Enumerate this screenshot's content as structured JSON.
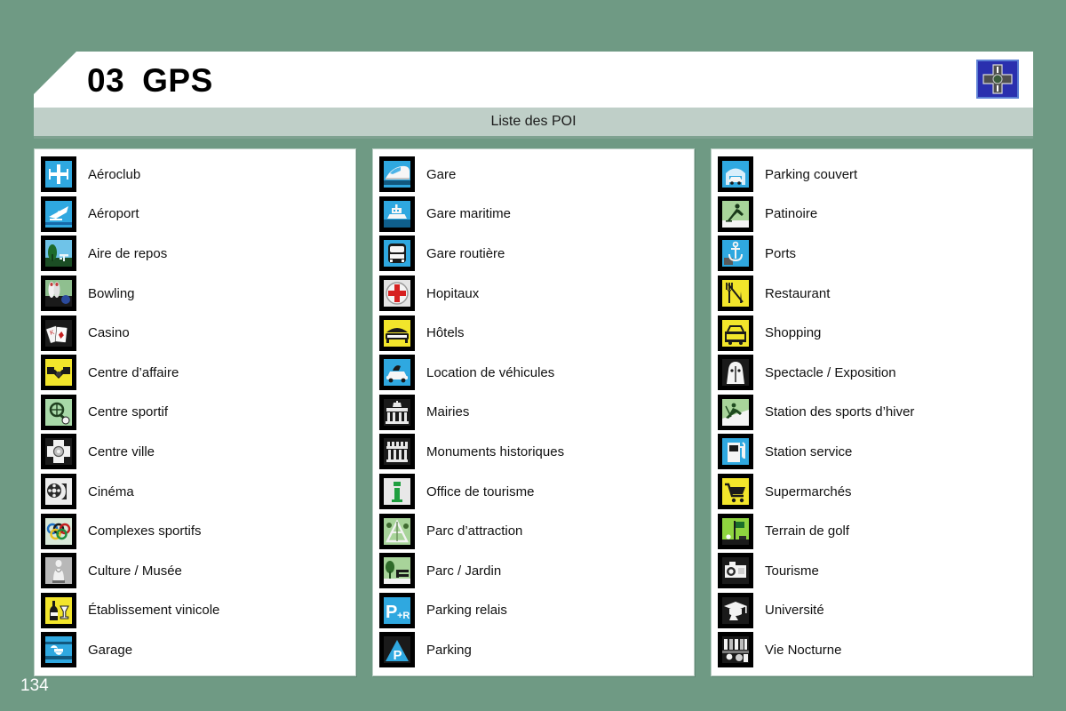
{
  "page": {
    "background_color": "#6f9a84",
    "page_number": "134"
  },
  "header": {
    "chapter_number": "03",
    "title": "GPS",
    "corner_icon": "crossroads-icon",
    "corner_icon_color": "#2a2fae"
  },
  "subtitle": {
    "text": "Liste des POI"
  },
  "columns": [
    {
      "items": [
        {
          "label": "Aéroclub",
          "icon": "small-plane-icon"
        },
        {
          "label": "Aéroport",
          "icon": "airplane-icon"
        },
        {
          "label": "Aire de repos",
          "icon": "rest-area-icon"
        },
        {
          "label": "Bowling",
          "icon": "bowling-icon"
        },
        {
          "label": "Casino",
          "icon": "playing-cards-icon"
        },
        {
          "label": "Centre d’affaire",
          "icon": "handshake-icon"
        },
        {
          "label": "Centre sportif",
          "icon": "sports-center-icon"
        },
        {
          "label": "Centre ville",
          "icon": "city-center-icon"
        },
        {
          "label": "Cinéma",
          "icon": "film-reel-icon"
        },
        {
          "label": "Complexes sportifs",
          "icon": "olympic-rings-icon"
        },
        {
          "label": "Culture / Musée",
          "icon": "statue-icon"
        },
        {
          "label": "Établissement vinicole",
          "icon": "wine-bottle-icon"
        },
        {
          "label": "Garage",
          "icon": "wrench-icon"
        }
      ]
    },
    {
      "items": [
        {
          "label": "Gare",
          "icon": "train-icon"
        },
        {
          "label": "Gare maritime",
          "icon": "ferry-icon"
        },
        {
          "label": "Gare routière",
          "icon": "bus-icon"
        },
        {
          "label": "Hopitaux",
          "icon": "red-cross-icon"
        },
        {
          "label": "Hôtels",
          "icon": "bed-icon"
        },
        {
          "label": "Location de véhicules",
          "icon": "car-rental-icon"
        },
        {
          "label": "Mairies",
          "icon": "town-hall-icon"
        },
        {
          "label": "Monuments historiques",
          "icon": "monument-icon"
        },
        {
          "label": "Office de tourisme",
          "icon": "information-icon"
        },
        {
          "label": "Parc d’attraction",
          "icon": "amusement-park-icon"
        },
        {
          "label": "Parc / Jardin",
          "icon": "park-garden-icon"
        },
        {
          "label": "Parking relais",
          "icon": "park-and-ride-icon"
        },
        {
          "label": "Parking",
          "icon": "parking-icon"
        }
      ]
    },
    {
      "items": [
        {
          "label": "Parking couvert",
          "icon": "covered-parking-icon"
        },
        {
          "label": "Patinoire",
          "icon": "ice-skating-icon"
        },
        {
          "label": "Ports",
          "icon": "anchor-icon"
        },
        {
          "label": "Restaurant",
          "icon": "cutlery-icon"
        },
        {
          "label": "Shopping",
          "icon": "shopping-icon"
        },
        {
          "label": "Spectacle / Exposition",
          "icon": "theatre-icon"
        },
        {
          "label": "Station des sports d’hiver",
          "icon": "skier-icon"
        },
        {
          "label": "Station service",
          "icon": "fuel-pump-icon"
        },
        {
          "label": "Supermarchés",
          "icon": "shopping-cart-icon"
        },
        {
          "label": "Terrain de golf",
          "icon": "golf-flag-icon"
        },
        {
          "label": "Tourisme",
          "icon": "camera-icon"
        },
        {
          "label": "Université",
          "icon": "graduation-cap-icon"
        },
        {
          "label": "Vie Nocturne",
          "icon": "nightlife-icon"
        }
      ]
    }
  ]
}
